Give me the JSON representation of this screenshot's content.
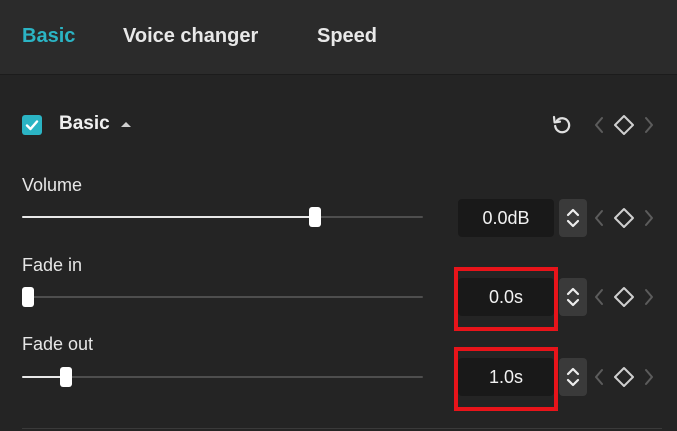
{
  "tabs": [
    {
      "label": "Basic",
      "active": true
    },
    {
      "label": "Voice changer",
      "active": false
    },
    {
      "label": "Speed",
      "active": false
    }
  ],
  "accent_color": "#2bb4c4",
  "highlight_color": "#e8141a",
  "section": {
    "title": "Basic",
    "checked": true,
    "expanded": true
  },
  "controls": [
    {
      "id": "volume",
      "label": "Volume",
      "value": "0.0dB",
      "slider_fraction": 0.73
    },
    {
      "id": "fade_in",
      "label": "Fade in",
      "value": "0.0s",
      "slider_fraction": 0.0
    },
    {
      "id": "fade_out",
      "label": "Fade out",
      "value": "1.0s",
      "slider_fraction": 0.11
    }
  ],
  "icons": {
    "reset": "reset-icon",
    "keyframe": "keyframe-diamond-icon",
    "prev": "chevron-left-icon",
    "next": "chevron-right-icon",
    "stepper": "up-down-stepper-icon"
  }
}
